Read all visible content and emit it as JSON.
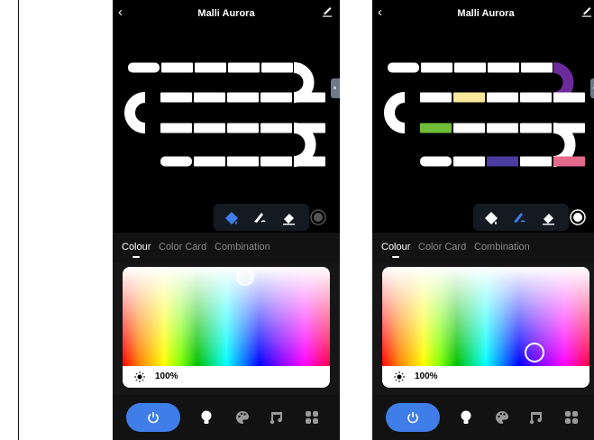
{
  "screens": [
    {
      "header": {
        "back_icon": "back-chevron-icon",
        "title": "Malli Aurora",
        "edit_icon": "pencil-icon"
      },
      "strip": {
        "segment_colors": [
          "#ffffff",
          "#ffffff",
          "#ffffff",
          "#ffffff",
          "#ffffff",
          "#ffffff",
          "#ffffff",
          "#ffffff",
          "#ffffff",
          "#ffffff",
          "#ffffff",
          "#ffffff",
          "#ffffff",
          "#ffffff",
          "#ffffff",
          "#ffffff",
          "#ffffff",
          "#ffffff",
          "#ffffff",
          "#ffffff"
        ],
        "curve_colors": [
          "#ffffff",
          "#ffffff",
          "#ffffff"
        ]
      },
      "tools": {
        "active": "paint-bucket-icon"
      },
      "tabs": [
        {
          "label": "Colour",
          "active": true
        },
        {
          "label": "Color Card"
        },
        {
          "label": "Combination"
        }
      ],
      "brightness": {
        "value": "100%"
      },
      "picker_handle": {
        "hue_fraction": 0.59,
        "saturation_fraction": 0.1
      },
      "nav": {
        "power_icon": "power-icon",
        "items": [
          "bulb-icon",
          "palette-icon",
          "music-icon",
          "scenes-icon"
        ]
      }
    },
    {
      "header": {
        "back_icon": "back-chevron-icon",
        "title": "Malli Aurora",
        "edit_icon": "pencil-icon"
      },
      "strip": {
        "segment_colors": [
          "#ffffff",
          "#ffffff",
          "#ffffff",
          "#ffffff",
          "#ffffff",
          "#ffffff",
          "#f6e79a",
          "#ffffff",
          "#ffffff",
          "#ffffff",
          "#6fbe3a",
          "#ffffff",
          "#ffffff",
          "#ffffff",
          "#ffffff",
          "#ffffff",
          "#ffffff",
          "#4a3ca0",
          "#ffffff",
          "#e36a8c"
        ],
        "curve_colors": [
          "#6b2b9a",
          "#ffffff",
          "#ffffff"
        ]
      },
      "tools": {
        "active": "pen-icon"
      },
      "tabs": [
        {
          "label": "Colour",
          "active": true
        },
        {
          "label": "Color Card"
        },
        {
          "label": "Combination"
        }
      ],
      "brightness": {
        "value": "100%"
      },
      "picker_handle": {
        "hue_fraction": 0.73,
        "saturation_fraction": 0.85
      },
      "nav": {
        "power_icon": "power-icon",
        "items": [
          "bulb-icon",
          "palette-icon",
          "music-icon",
          "scenes-icon"
        ]
      }
    }
  ]
}
